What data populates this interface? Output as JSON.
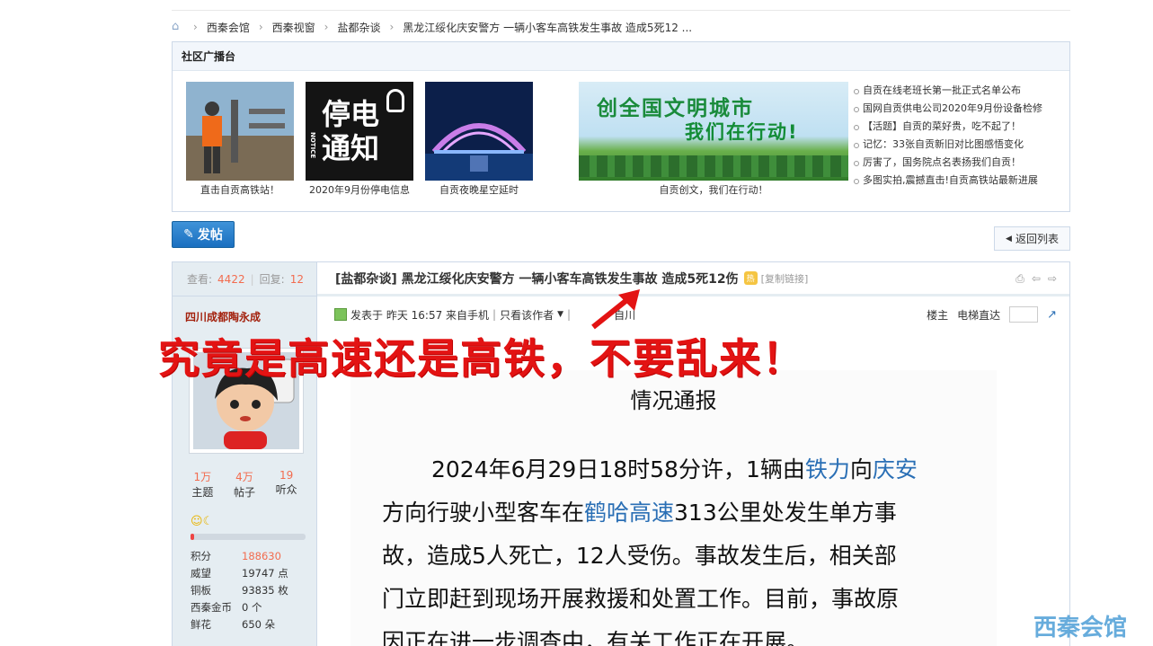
{
  "breadcrumb": [
    "西秦会馆",
    "西秦视窗",
    "盐都杂谈",
    "黑龙江绥化庆安警方 一辆小客车高铁发生事故 造成5死12 ..."
  ],
  "community": {
    "title": "社区广播台",
    "thumbs": [
      {
        "caption": "直击自贡高铁站！"
      },
      {
        "caption": "2020年9月份停电信息",
        "img_text_1": "停电",
        "img_text_2": "通知",
        "img_text_3": "NOTICE"
      },
      {
        "caption": "自贡夜晚星空延时"
      }
    ],
    "banner": {
      "line1": "创全国文明城市",
      "line2": "我们在行动!",
      "caption": "自贡创文，我们在行动！"
    },
    "news": [
      "自贡在线老班长第一批正式名单公布",
      "国网自贡供电公司2020年9月份设备检修",
      "【活题】自贡的菜好贵，吃不起了！",
      "记忆：33张自贡新旧对比图感悟变化",
      "厉害了，国务院点名表扬我们自贡！",
      "多图实拍,震撼直击!自贡高铁站最新进展"
    ]
  },
  "buttons": {
    "post": "发帖",
    "back": "返回列表"
  },
  "thread": {
    "views_label": "查看:",
    "views": "4422",
    "replies_label": "回复:",
    "replies": "12",
    "title": "[盐都杂谈] 黑龙江绥化庆安警方 一辆小客车高铁发生事故 造成5死12伤",
    "copy_link": "[复制链接]",
    "author": "四川成都陶永成",
    "meta_posted": "发表于 昨天 16:57 来自手机",
    "meta_only_author": "只看该作者",
    "meta_extra": "自川",
    "floor": "楼主",
    "jump": "电梯直达"
  },
  "user": {
    "counts": [
      {
        "value": "1万",
        "label": "主题"
      },
      {
        "value": "4万",
        "label": "帖子"
      },
      {
        "value": "19",
        "label": "听众"
      }
    ],
    "props": [
      {
        "k": "积分",
        "v": "188630"
      },
      {
        "k": "威望",
        "v": "19747 点"
      },
      {
        "k": "铜板",
        "v": "93835 枚"
      },
      {
        "k": "西秦金币",
        "v": "0 个"
      },
      {
        "k": "鲜花",
        "v": "650 朵"
      }
    ]
  },
  "report": {
    "title": "情况通报",
    "p1_a": "2024年6月29日18时58分许，1辆由",
    "p1_link1": "铁力",
    "p1_b": "向",
    "p1_link2": "庆安",
    "p2_a": "方向行驶小型客车在",
    "p2_link": "鹤哈高速",
    "p2_b": "313公里处发生单方事",
    "p3": "故，造成5人死亡，12人受伤。事故发生后，相关部",
    "p4": "门立即赶到现场开展救援和处置工作。目前，事故原",
    "p5": "因正在进一步调查中，有关工作正在开展。"
  },
  "overlay_text": "究竟是高速还是高铁，不要乱来！",
  "watermark": "西秦会馆"
}
